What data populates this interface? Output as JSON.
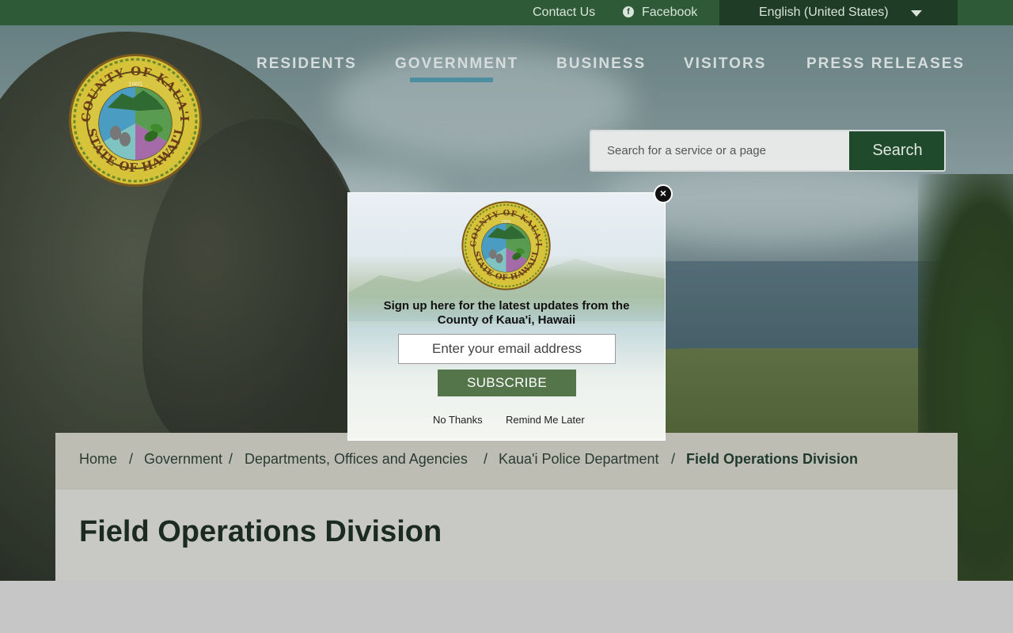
{
  "utility": {
    "contact": "Contact Us",
    "facebook": "Facebook",
    "language": "English (United States)"
  },
  "nav": {
    "items": [
      {
        "label": "RESIDENTS"
      },
      {
        "label": "GOVERNMENT"
      },
      {
        "label": "BUSINESS"
      },
      {
        "label": "VISITORS"
      },
      {
        "label": "PRESS RELEASES"
      }
    ],
    "active": "GOVERNMENT"
  },
  "search": {
    "placeholder": "Search for a service or a page",
    "button": "Search"
  },
  "seal": {
    "top_text": "COUNTY OF KAUA'I",
    "bottom_text": "STATE OF HAWAI'I",
    "year": "1905"
  },
  "breadcrumb": {
    "items": [
      "Home",
      "Government",
      "Departments, Offices and Agencies",
      "Kaua'i Police Department"
    ],
    "current": "Field Operations Division"
  },
  "page": {
    "title": "Field Operations Division"
  },
  "modal": {
    "message": "Sign up here for the latest updates from the County of Kaua'i, Hawaii",
    "email_placeholder": "Enter your email address",
    "subscribe": "SUBSCRIBE",
    "no_thanks": "No Thanks",
    "remind": "Remind Me Later"
  },
  "colors": {
    "topbar": "#2f5a38",
    "language_bar": "#1f3d26",
    "search_button": "#1f4a2c",
    "nav_underline": "#4d8fa0",
    "subscribe": "#54744a"
  }
}
